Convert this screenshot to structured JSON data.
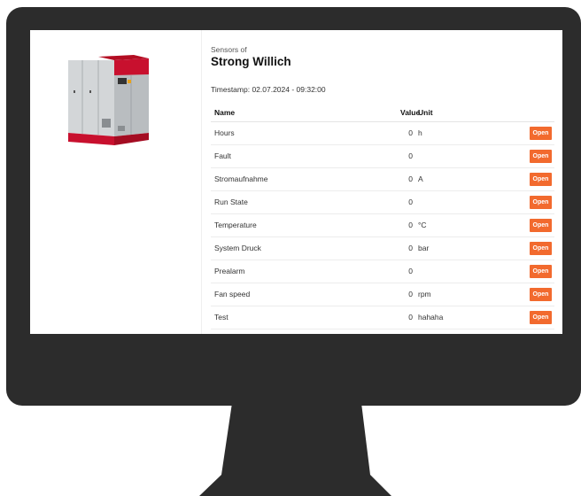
{
  "machine": {
    "subtitle": "Sensors of",
    "name": "Strong Willich",
    "timestamp": "Timestamp: 02.07.2024 - 09:32:00",
    "image_icon": "compressor-machine-icon"
  },
  "table": {
    "headers": {
      "name": "Name",
      "value": "Value",
      "unit": "Unit"
    },
    "open_label": "Open",
    "rows": [
      {
        "name": "Hours",
        "value": "0",
        "unit": "h"
      },
      {
        "name": "Fault",
        "value": "0",
        "unit": ""
      },
      {
        "name": "Stromaufnahme",
        "value": "0",
        "unit": "A"
      },
      {
        "name": "Run State",
        "value": "0",
        "unit": ""
      },
      {
        "name": "Temperature",
        "value": "0",
        "unit": "°C"
      },
      {
        "name": "System Druck",
        "value": "0",
        "unit": "bar"
      },
      {
        "name": "Prealarm",
        "value": "0",
        "unit": ""
      },
      {
        "name": "Fan speed",
        "value": "0",
        "unit": "rpm"
      },
      {
        "name": "Test",
        "value": "0",
        "unit": "hahaha"
      }
    ]
  },
  "colors": {
    "accent": "#f26a2e",
    "frame": "#2c2c2c",
    "machine_red": "#c8102e"
  }
}
